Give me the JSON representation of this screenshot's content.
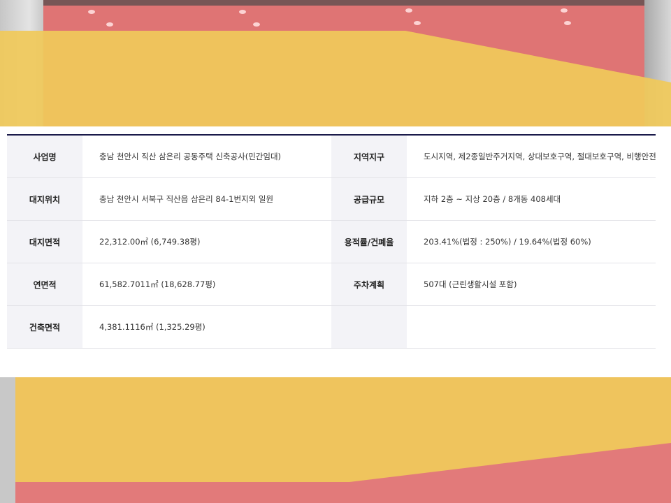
{
  "project_info": {
    "rows": [
      {
        "label_left": "사업명",
        "value_left": "충남 천안시 직산 삼은리 공동주택 신축공사(민간임대)",
        "label_right": "지역지구",
        "value_right": "도시지역, 제2종일반주거지역, 상대보호구역, 절대보호구역, 비행안전구역"
      },
      {
        "label_left": "대지위치",
        "value_left": "충남 천안시 서북구 직산읍 삼은리 84-1번지외 일원",
        "label_right": "공급규모",
        "value_right": "지하 2층 ~ 지상 20층 / 8개동 408세대"
      },
      {
        "label_left": "대지면적",
        "value_left": "22,312.00㎡ (6,749.38평)",
        "label_right": "용적률/건폐율",
        "value_right": "203.41%(법정 : 250%) / 19.64%(법정 60%)"
      },
      {
        "label_left": "연면적",
        "value_left": "61,582.7011㎡ (18,628.77평)",
        "label_right": "주차계획",
        "value_right": "507대 (근린생활시설 포함)"
      },
      {
        "label_left": "건축면적",
        "value_left": "4,381.1116㎡ (1,325.29평)",
        "label_right": "",
        "value_right": ""
      }
    ]
  },
  "colors": {
    "header_cell_bg": "#f3f3f7",
    "top_rule": "#1a1a4a",
    "accent_red": "#df7474",
    "accent_yellow": "#f0c95a"
  }
}
